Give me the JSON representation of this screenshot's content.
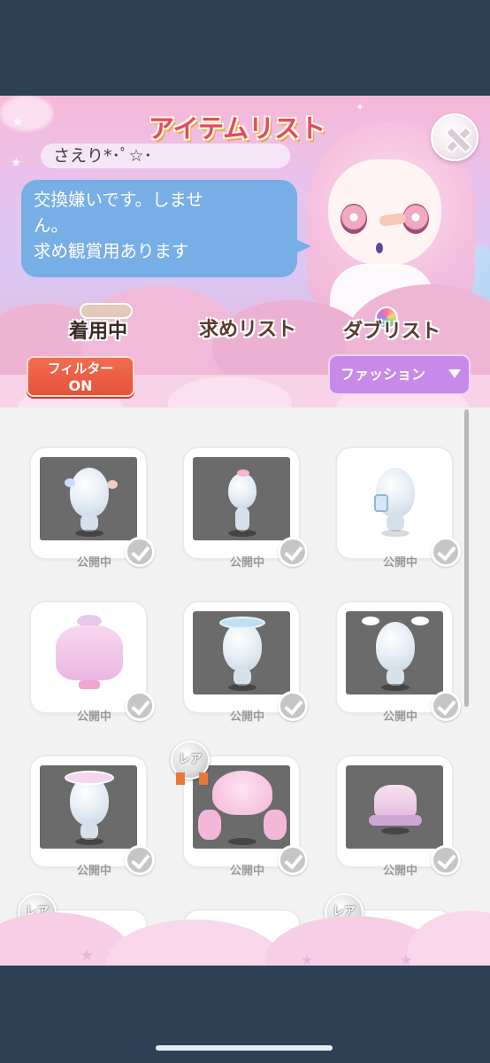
{
  "header": {
    "title": "アイテムリスト",
    "username": "さえり*･ﾟ☆･",
    "message_lines": [
      "交換嫌いです。しませ",
      "ん。",
      "求め観賞用あります"
    ]
  },
  "tabs": [
    {
      "label": "着用中",
      "active": true
    },
    {
      "label": "求めリスト",
      "active": false
    },
    {
      "label": "ダブリスト",
      "active": false
    }
  ],
  "filter": {
    "line1": "フィルター",
    "line2": "ON",
    "color": "#e5523a"
  },
  "category": {
    "label": "ファッション",
    "color": "#c78ae8"
  },
  "items": [
    {
      "status": "公開中",
      "rare": false,
      "icon": "bear-ears-hairpiece-icon"
    },
    {
      "status": "公開中",
      "rare": false,
      "icon": "bow-accessory-icon"
    },
    {
      "status": "公開中",
      "rare": false,
      "icon": "badge-accessory-icon"
    },
    {
      "status": "公開中",
      "rare": false,
      "icon": "pink-dress-icon"
    },
    {
      "status": "公開中",
      "rare": false,
      "icon": "headband-icon"
    },
    {
      "status": "公開中",
      "rare": false,
      "icon": "angel-wings-icon"
    },
    {
      "status": "公開中",
      "rare": false,
      "icon": "frill-bonnet-icon"
    },
    {
      "status": "公開中",
      "rare": true,
      "rare_label": "レア",
      "icon": "pink-hair-icon"
    },
    {
      "status": "公開中",
      "rare": false,
      "icon": "pink-hat-icon"
    }
  ],
  "partial_row": {
    "rare_label": "レア"
  },
  "colors": {
    "accent_pink": "#e7456f",
    "bubble_blue": "#78aee6",
    "status_bar": "#2c4254"
  }
}
